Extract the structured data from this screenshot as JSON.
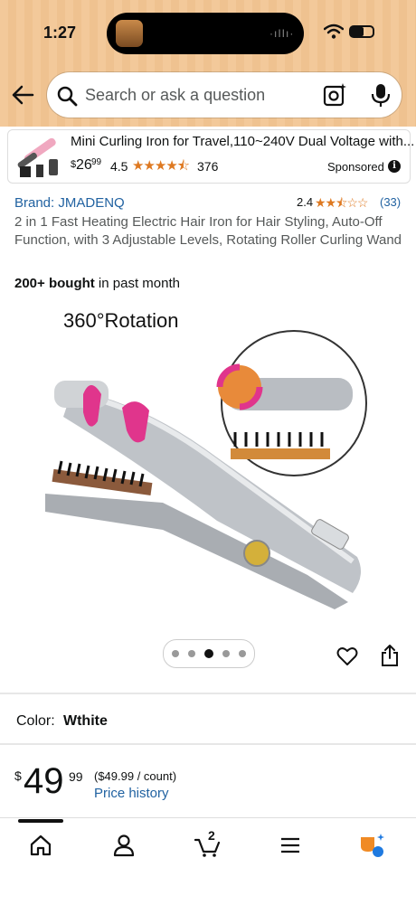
{
  "status_bar": {
    "time": "1:27",
    "audio_indicator": "·ıIIı·"
  },
  "search": {
    "placeholder": "Search or ask a question"
  },
  "sponsored_ad": {
    "title": "Mini Curling Iron for Travel,110~240V Dual Voltage with...",
    "price_symbol": "$",
    "price_whole": "26",
    "price_cents": "99",
    "rating": "4.5",
    "stars": "★★★★⯪",
    "review_count": "376",
    "label": "Sponsored",
    "info": "i"
  },
  "product": {
    "brand": "Brand: JMADENQ",
    "rating": "2.4",
    "stars": "★★⯪☆☆",
    "review_count": "(33)",
    "title": "2 in 1 Fast Heating Electric Hair Iron for Hair Styling, Auto-Off Function, with 3 Adjustable Levels, Rotating Roller Curling Wand",
    "bought_bold": "200+ bought",
    "bought_rest": " in past month",
    "image_caption": "360°Rotation",
    "image_count": 5,
    "image_index": 3
  },
  "color": {
    "label": "Color:",
    "value": "Wthite"
  },
  "price": {
    "symbol": "$",
    "whole": "49",
    "cents": "99",
    "per_unit": "($49.99 / count)",
    "history_link": "Price history"
  },
  "bottom_nav": {
    "items": [
      "home-icon",
      "account-icon",
      "cart-icon",
      "menu-icon",
      "rufus-icon"
    ],
    "cart_count": "2"
  },
  "colors": {
    "accent_link": "#2162a1",
    "star": "#de7921",
    "header_bg": "#f3c99a",
    "rotation_pink": "#e0358c"
  }
}
